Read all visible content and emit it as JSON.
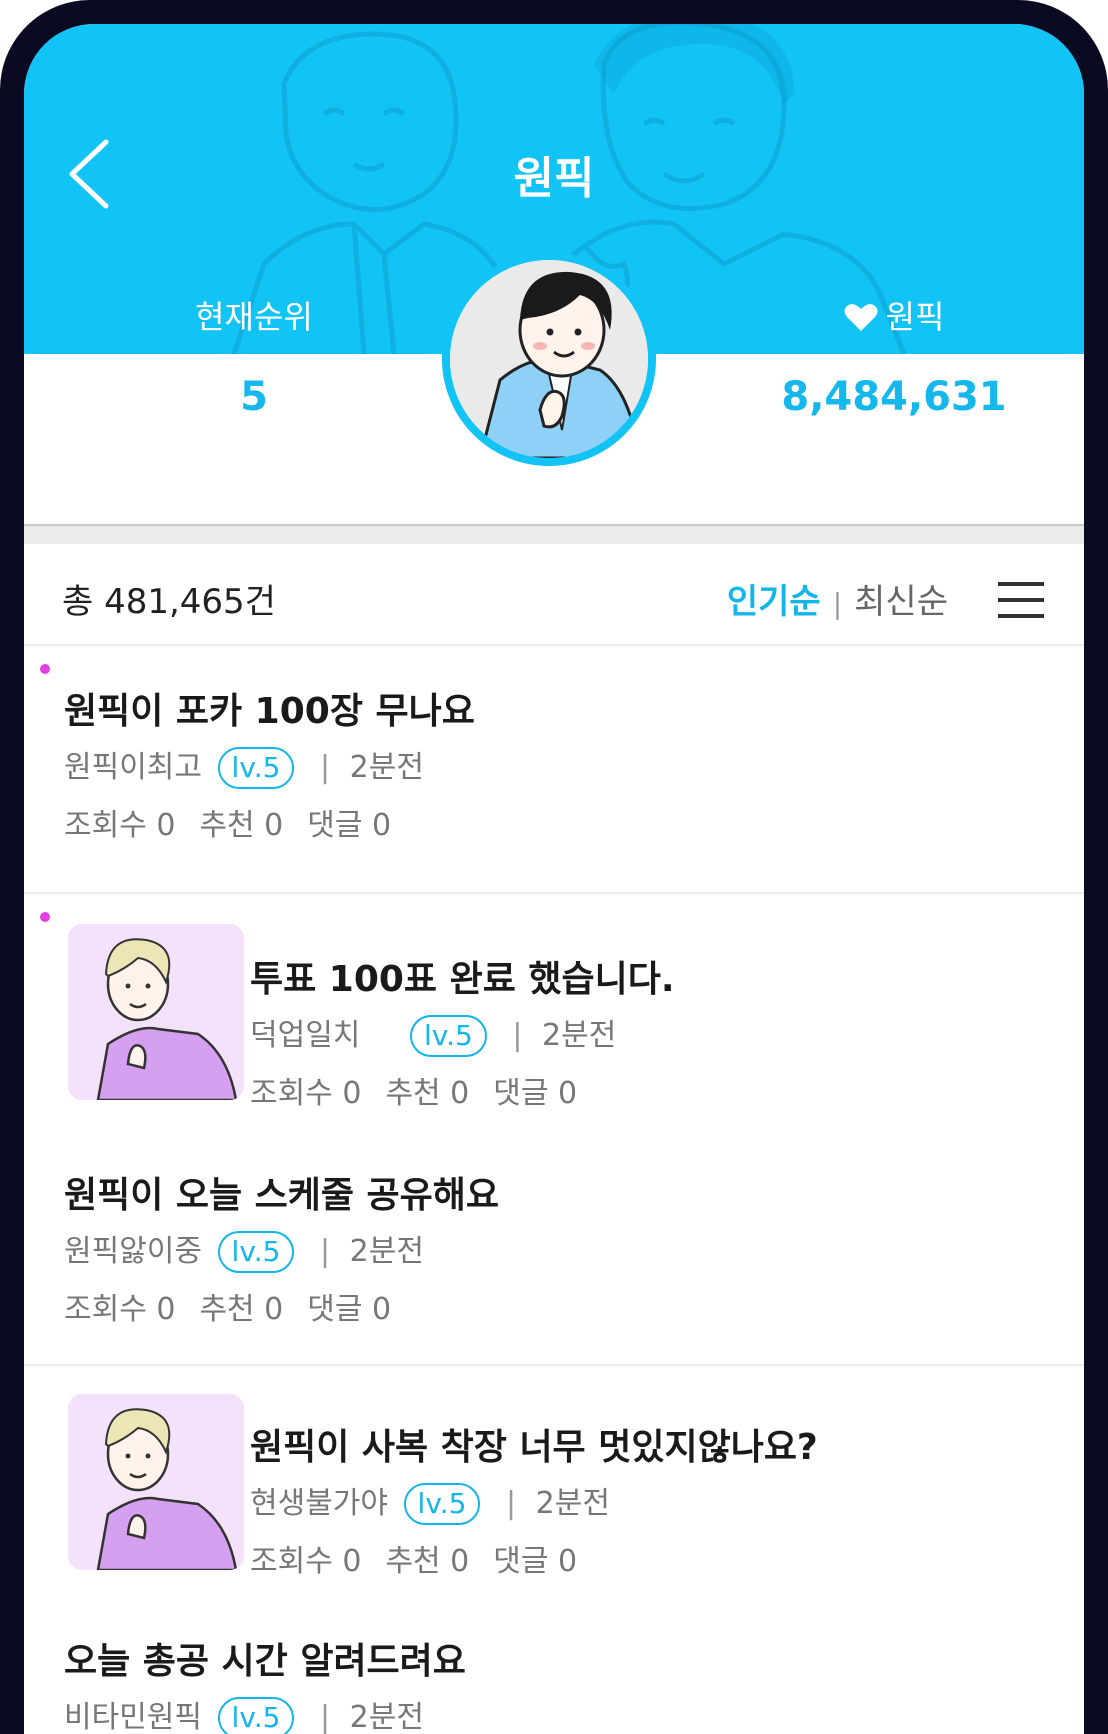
{
  "header": {
    "title": "원픽",
    "rank_label": "현재순위",
    "rank_value": "5",
    "pick_label": "원픽",
    "pick_value": "8,484,631"
  },
  "list": {
    "total": "총 481,465건",
    "sort_popular": "인기순",
    "sort_divider": "|",
    "sort_latest": "최신순"
  },
  "posts": [
    {
      "title": "원픽이 포카 100장 무나요",
      "author": "원픽이최고",
      "level": "lv.5",
      "time": "2분전",
      "views": "조회수 0",
      "likes": "추천 0",
      "comments": "댓글 0",
      "new": true,
      "has_thumb": false
    },
    {
      "title": "투표 100표 완료 했습니다.",
      "author": "덕업일치",
      "level": "lv.5",
      "time": "2분전",
      "views": "조회수 0",
      "likes": "추천 0",
      "comments": "댓글 0",
      "new": true,
      "has_thumb": true
    },
    {
      "title": "원픽이 오늘 스케줄 공유해요",
      "author": "원픽앓이중",
      "level": "lv.5",
      "time": "2분전",
      "views": "조회수 0",
      "likes": "추천 0",
      "comments": "댓글 0",
      "new": false,
      "has_thumb": false
    },
    {
      "title": "원픽이 사복 착장 너무 멋있지않나요?",
      "author": "현생불가야",
      "level": "lv.5",
      "time": "2분전",
      "views": "조회수 0",
      "likes": "추천 0",
      "comments": "댓글 0",
      "new": false,
      "has_thumb": true
    },
    {
      "title": "오늘 총공 시간 알려드려요",
      "author": "비타민원픽",
      "level": "lv.5",
      "time": "2분전",
      "new": false,
      "has_thumb": false
    }
  ],
  "icons": {
    "back": "chevron-left-icon",
    "heart": "heart-icon",
    "menu": "hamburger-menu-icon",
    "new_dot": "new-post-dot-icon"
  },
  "colors": {
    "accent": "#12c3f6",
    "accent_text": "#12b6ea",
    "new_dot": "#e040e0",
    "frame": "#0a0a23"
  }
}
